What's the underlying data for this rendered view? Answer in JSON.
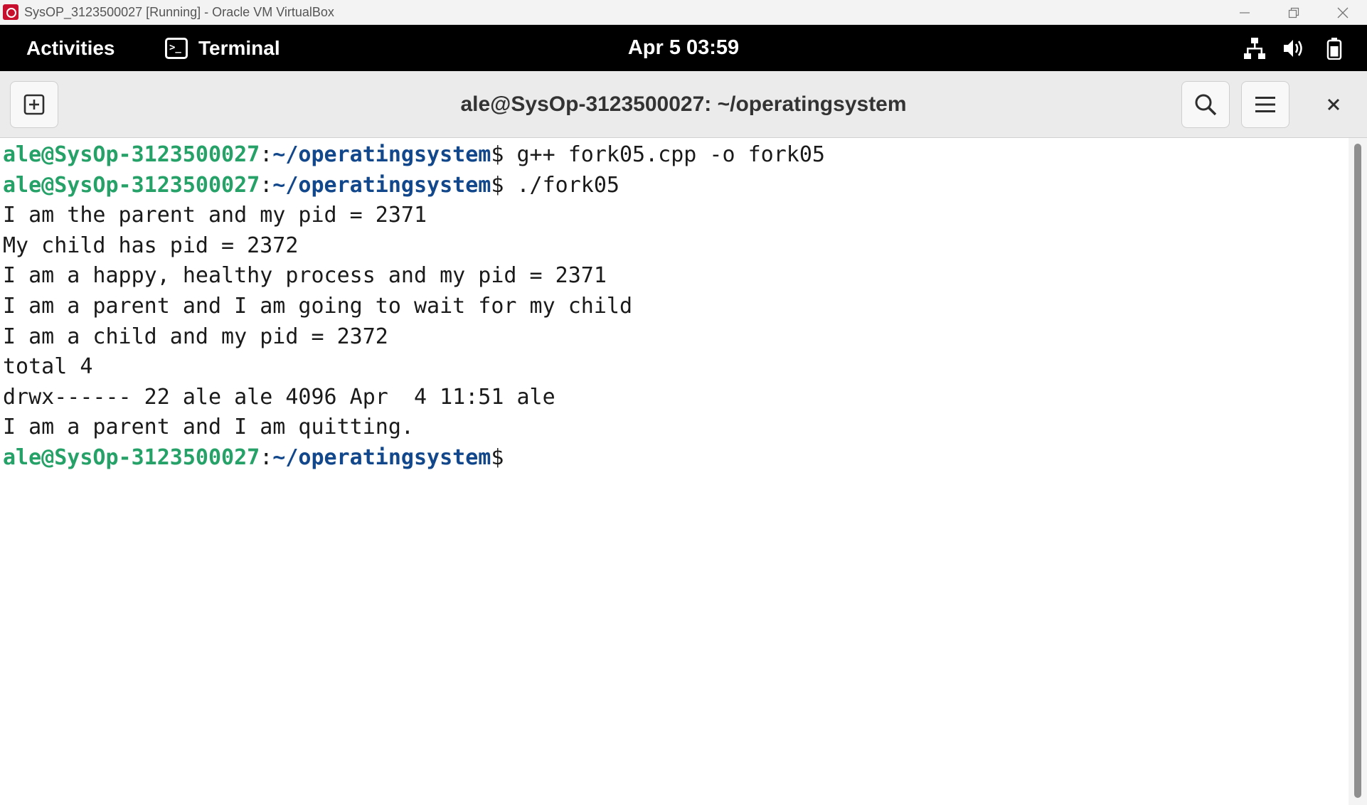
{
  "host_window": {
    "title": "SysOP_3123500027 [Running] - Oracle VM VirtualBox",
    "minimize": "—",
    "restore": "❐",
    "close": "✕"
  },
  "topbar": {
    "activities": "Activities",
    "app_name": "Terminal",
    "app_icon_glyph": ">_",
    "clock": "Apr 5  03:59",
    "tray_icons": [
      "network-icon",
      "volume-icon",
      "battery-icon"
    ]
  },
  "terminal": {
    "title": "ale@SysOp-3123500027: ~/operatingsystem",
    "prompt_user": "ale@SysOp-3123500027",
    "prompt_sep": ":",
    "prompt_path": "~/operatingsystem",
    "prompt_symbol": "$",
    "lines": [
      {
        "type": "prompt",
        "command": " g++ fork05.cpp -o fork05"
      },
      {
        "type": "prompt",
        "command": " ./fork05"
      },
      {
        "type": "output",
        "text": "I am the parent and my pid = 2371"
      },
      {
        "type": "output",
        "text": "My child has pid = 2372"
      },
      {
        "type": "output",
        "text": "I am a happy, healthy process and my pid = 2371"
      },
      {
        "type": "output",
        "text": "I am a parent and I am going to wait for my child"
      },
      {
        "type": "output",
        "text": "I am a child and my pid = 2372"
      },
      {
        "type": "output",
        "text": "total 4"
      },
      {
        "type": "output",
        "text": "drwx------ 22 ale ale 4096 Apr  4 11:51 ale"
      },
      {
        "type": "output",
        "text": "I am a parent and I am quitting."
      },
      {
        "type": "prompt",
        "command": ""
      }
    ]
  },
  "colors": {
    "prompt_user": "#26a269",
    "prompt_path": "#12488b",
    "topbar_bg": "#000000",
    "header_bg": "#ebebeb"
  }
}
